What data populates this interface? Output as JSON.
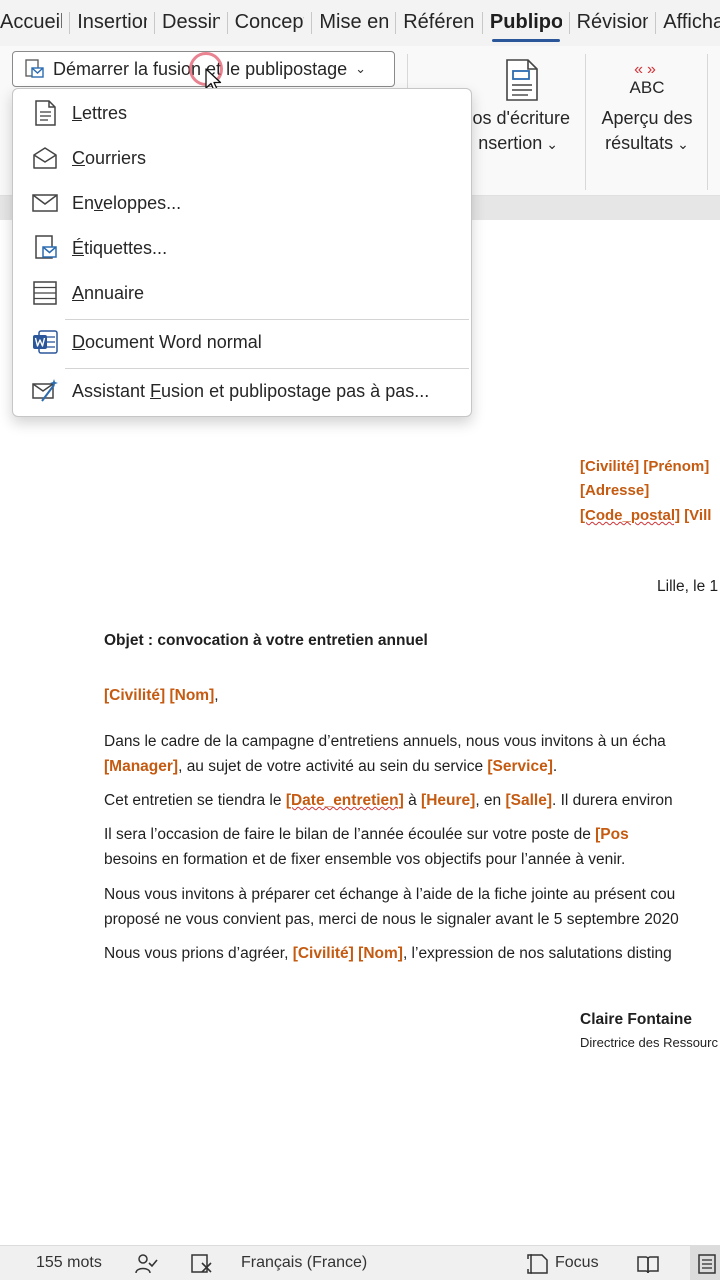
{
  "tabs": [
    "Accueil",
    "Insertion",
    "Dessin",
    "Conception",
    "Mise en page",
    "Références",
    "Publipostage",
    "Révision",
    "Affichage"
  ],
  "ribbon": {
    "start_merge_label": "Démarrer la fusion et le publipostage",
    "write_insert_line1": "os d'écriture",
    "write_insert_line2": "nsertion",
    "preview_abc": "ABC",
    "preview_line1": "Aperçu des",
    "preview_line2": "résultats"
  },
  "menu": {
    "items": [
      {
        "pre": "",
        "u": "L",
        "post": "ettres",
        "icon": "letter-icon"
      },
      {
        "pre": "",
        "u": "C",
        "post": "ourriers",
        "icon": "mail-icon"
      },
      {
        "pre": "En",
        "u": "v",
        "post": "eloppes...",
        "icon": "envelope-icon"
      },
      {
        "pre": "",
        "u": "É",
        "post": "tiquettes...",
        "icon": "labels-icon"
      },
      {
        "pre": "",
        "u": "A",
        "post": "nnuaire",
        "icon": "directory-icon"
      },
      {
        "pre": "",
        "u": "D",
        "post": "ocument Word normal",
        "icon": "word-icon"
      },
      {
        "pre": "Assistant ",
        "u": "F",
        "post": "usion et publipostage pas à pas...",
        "icon": "wizard-icon"
      }
    ]
  },
  "document": {
    "addr_civilite": "[Civilité]",
    "addr_prenom": "[Prénom]",
    "addr_adresse": "[Adresse]",
    "addr_cp": "[Code_postal]",
    "addr_ville": "[Vill",
    "date_line": "Lille, le 1",
    "objet": "Objet : convocation à votre entretien annuel",
    "salut_civ": "[Civilité]",
    "salut_nom": "[Nom]",
    "salut_comma": ",",
    "p1_a": "Dans le cadre de la campagne d’entretiens annuels, nous vous invitons à un écha",
    "p1_manager": "[Manager]",
    "p1_b": ", au sujet de votre activité au sein du service ",
    "p1_service": "[Service]",
    "p1_c": ".",
    "p2_a": "Cet entretien se tiendra le ",
    "p2_date": "[Date_entretien]",
    "p2_b": " à ",
    "p2_heure": "[Heure]",
    "p2_c": ", en ",
    "p2_salle": "[Salle]",
    "p2_d": ". Il durera environ",
    "p3_a": "Il sera l’occasion de faire le bilan de l’année écoulée sur votre poste de ",
    "p3_poste": "[Pos",
    "p3_b": "besoins en formation et de fixer ensemble vos objectifs pour l’année à venir.",
    "p4_a": "Nous vous invitons à préparer cet échange à l’aide de la fiche jointe au présent cou",
    "p4_b": "proposé ne vous convient pas, merci de nous le signaler avant le 5 septembre 2020",
    "p5_a": "Nous vous prions d’agréer, ",
    "p5_civ": "[Civilité]",
    "p5_nom": "[Nom]",
    "p5_b": ", l’expression de nos salutations disting",
    "sign_name": "Claire Fontaine",
    "sign_title": "Directrice des Ressourc"
  },
  "status": {
    "words": "155 mots",
    "language": "Français (France)",
    "focus": "Focus"
  },
  "colors": {
    "field": "#c55a11",
    "accent": "#2b579a",
    "squiggle": "#d13438"
  }
}
